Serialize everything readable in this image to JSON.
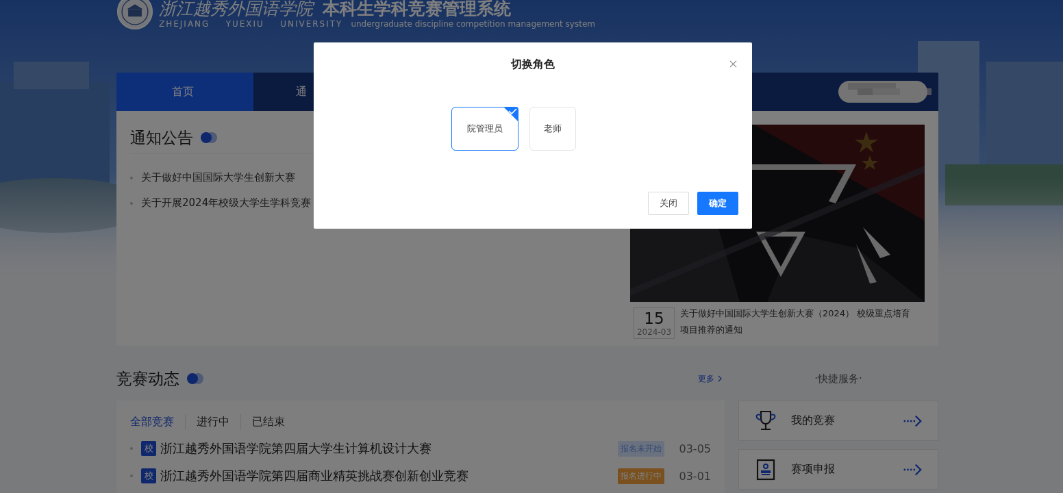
{
  "header": {
    "school_name_cn": "浙江越秀外国语学院",
    "system_name_cn": "本科生学科竞赛管理系统",
    "school_name_en": "ZHEJIANG    YUEXIU    UNIVERSITY",
    "system_name_en": "undergraduate discipline competition management system"
  },
  "nav": {
    "tabs": [
      {
        "label": "首页",
        "selected": true
      },
      {
        "label": "通",
        "selected": false
      }
    ]
  },
  "notices": {
    "title": "通知公告",
    "items": [
      {
        "title": "关于做好中国国际大学生创新大赛"
      },
      {
        "title": "关于开展2024年校级大学生学科竞赛"
      }
    ],
    "featured": {
      "kind": "picture",
      "day": "15",
      "month": "2024-03",
      "caption": "关于做好中国国际大学生创新大赛（2024） 校级重点培育项目推荐的通知"
    }
  },
  "competitions": {
    "title": "竞赛动态",
    "more": "更多",
    "filters": [
      {
        "label": "全部竞赛",
        "selected": true
      },
      {
        "label": "进行中",
        "selected": false
      },
      {
        "label": "已结束",
        "selected": false
      }
    ],
    "rows": [
      {
        "badge": "校",
        "title": "浙江越秀外国语学院第四届大学生计算机设计大赛",
        "status": "报名未开始",
        "kind": "pending",
        "date": "03-05"
      },
      {
        "badge": "校",
        "title": "浙江越秀外国语学院第四届商业精英挑战赛创新创业竞赛",
        "status": "报名进行中",
        "kind": "open",
        "date": "03-01"
      }
    ]
  },
  "quick_services": {
    "title": "·快捷服务·",
    "items": [
      {
        "label": "我的竞赛",
        "kind": "trophy"
      },
      {
        "label": "赛项申报",
        "kind": "stamp"
      }
    ]
  },
  "dialog": {
    "title": "切换角色",
    "roles": [
      {
        "label": "院管理员",
        "selected": true
      },
      {
        "label": "老师",
        "selected": false
      }
    ],
    "buttons": [
      {
        "label": "关闭",
        "kind": "secondary"
      },
      {
        "label": "确定",
        "kind": "primary"
      }
    ]
  }
}
